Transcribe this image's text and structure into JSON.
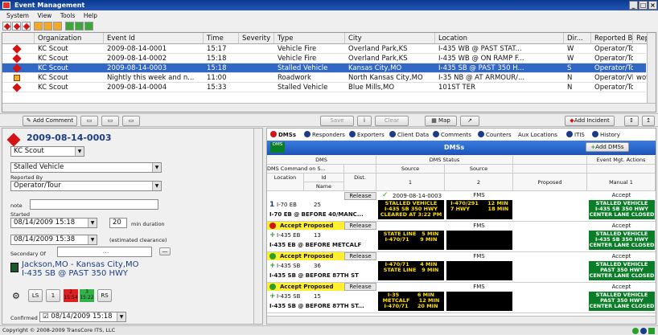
{
  "window": {
    "title": "Event Management"
  },
  "menu": [
    "System",
    "View",
    "Tools",
    "Help"
  ],
  "grid": {
    "headers": [
      "Organization",
      "Event Id",
      "Time",
      "Severity",
      "Type",
      "City",
      "Location",
      "Dir...",
      "Reported By",
      "Repo"
    ],
    "rows": [
      [
        "KC Scout",
        "2009-08-14-0001",
        "15:17",
        "",
        "Vehicle Fire",
        "Overland Park,KS",
        "I-435 WB @ PAST STAT...",
        "W",
        "Operator/Tour",
        ""
      ],
      [
        "KC Scout",
        "2009-08-14-0002",
        "15:18",
        "",
        "Vehicle Fire",
        "Overland Park,KS",
        "I-435 WB @ ON RAMP F...",
        "W",
        "Operator/Tour",
        ""
      ],
      [
        "KC Scout",
        "2009-08-14-0003",
        "15:18",
        "",
        "Stalled Vehicle",
        "Kansas City,MO",
        "I-435 SB @ PAST 350 H...",
        "S",
        "Operator/Tour",
        ""
      ],
      [
        "KC Scout",
        "Nightly this week and n...",
        "11:00",
        "",
        "Roadwork",
        "North Kansas City,MO",
        "I-35 NB @ AT ARMOUR/...",
        "N",
        "Operator/VDS",
        "wow"
      ],
      [
        "KC Scout",
        "2009-08-14-0004",
        "15:33",
        "",
        "Stalled Vehicle",
        "Blue Mills,MO",
        "101ST TER",
        "N",
        "Operator/Tour",
        ""
      ]
    ]
  },
  "midbar": {
    "add_comment": "Add Comment",
    "save": "Save",
    "clear": "Clear",
    "map": "Map",
    "add_incident": "Add Incident"
  },
  "left": {
    "event_id": "2009-08-14-0003",
    "org": "KC Scout",
    "type": "Stalled Vehicle",
    "reported_by_label": "Reported By",
    "reported_by": "Operator/Tour",
    "note_label": "note",
    "started_label": "Started",
    "started": "08/14/2009 15:18",
    "duration": "20",
    "duration_label": "min duration",
    "clearance": "08/14/2009 15:38",
    "clearance_label": "(estimated clearance)",
    "secondary_label": "Secondary Of",
    "secondary_btn": "...",
    "location_line1": "Jackson,MO - Kansas City,MO",
    "location_line2": "I-435 SB @ PAST 350 HWY",
    "lanes": [
      "LS",
      "1",
      "2",
      "3",
      "RS"
    ],
    "lane_times": [
      "15:54",
      "15:22"
    ],
    "confirmed_label": "Confirmed",
    "confirmed": "08/14/2009 15:18"
  },
  "tabs": [
    "DMSs",
    "Responders",
    "Exporters",
    "Client Data",
    "Comments",
    "Counters",
    "Aux Locations",
    "ITIS",
    "History"
  ],
  "dms": {
    "header": "DMSs",
    "add_btn": "Add DMSs",
    "badge": "DMS",
    "cols": {
      "dms": "DMS",
      "status": "DMS Status",
      "actions": "Event Mgt. Actions",
      "command": "DMS Command on S...",
      "source": "Source",
      "location": "Location",
      "id": "Id",
      "dist": "Dist.",
      "name": "Name",
      "one": "1",
      "two": "2",
      "proposed": "Proposed",
      "manual": "Manual 1"
    },
    "rows": [
      {
        "action": "Release",
        "cmd": "2009-08-14-0003",
        "src": "FMS",
        "prop": "Accept",
        "road": "I-70 EB",
        "id": "25",
        "name": "I-70 EB @ BEFORE 40/MANC...",
        "m1": "STALLED VEHICLE\nI-435 SB 350 HWY\nCLEARED AT 3:22 PM",
        "m2": "I-470/291     12 MIN\n7 HWY          18 MIN",
        "m3": "STALLED VEHICLE\nI-435 SB 350 HWY\nCENTER LANE CLOSED"
      },
      {
        "action": "Release",
        "cmd": "Accept Proposed",
        "src": "FMS",
        "prop": "Accept",
        "road": "I-435 EB",
        "id": "13",
        "name": "I-435 EB @ BEFORE METCALF",
        "m1": "STATE LINE   5 MIN\nI-470/71      9 MIN",
        "m2": "",
        "m3": "STALLED VEHICLE\nI-435 SB 350 HWY\nCENTER LANE CLOSED"
      },
      {
        "action": "Release",
        "cmd": "Accept Proposed",
        "src": "FMS",
        "prop": "Accept",
        "road": "I-435 SB",
        "id": "36",
        "name": "I-435 SB @ BEFORE 87TH ST",
        "m1": "I-470/71      4 MIN\nSTATE LINE   9 MIN",
        "m2": "",
        "m3": "STALLED VEHICLE\nPAST 350 HWY\nCENTER LANE CLOSED"
      },
      {
        "action": "Release",
        "cmd": "Accept Proposed",
        "src": "FMS",
        "prop": "Accept",
        "road": "I-435 SB",
        "id": "15",
        "name": "I-435 SB @ BEFORE 87TH ST...",
        "m1": "I-35          6 MIN\nMETCALF     12 MIN\nI-470/71     20 MIN",
        "m2": "",
        "m3": "STALLED VEHICLE\nPAST 350 HWY\nCENTER LANE CLOSED"
      }
    ]
  },
  "status": {
    "copyright": "Copyright © 2008-2009 TransCore ITS, LLC"
  }
}
